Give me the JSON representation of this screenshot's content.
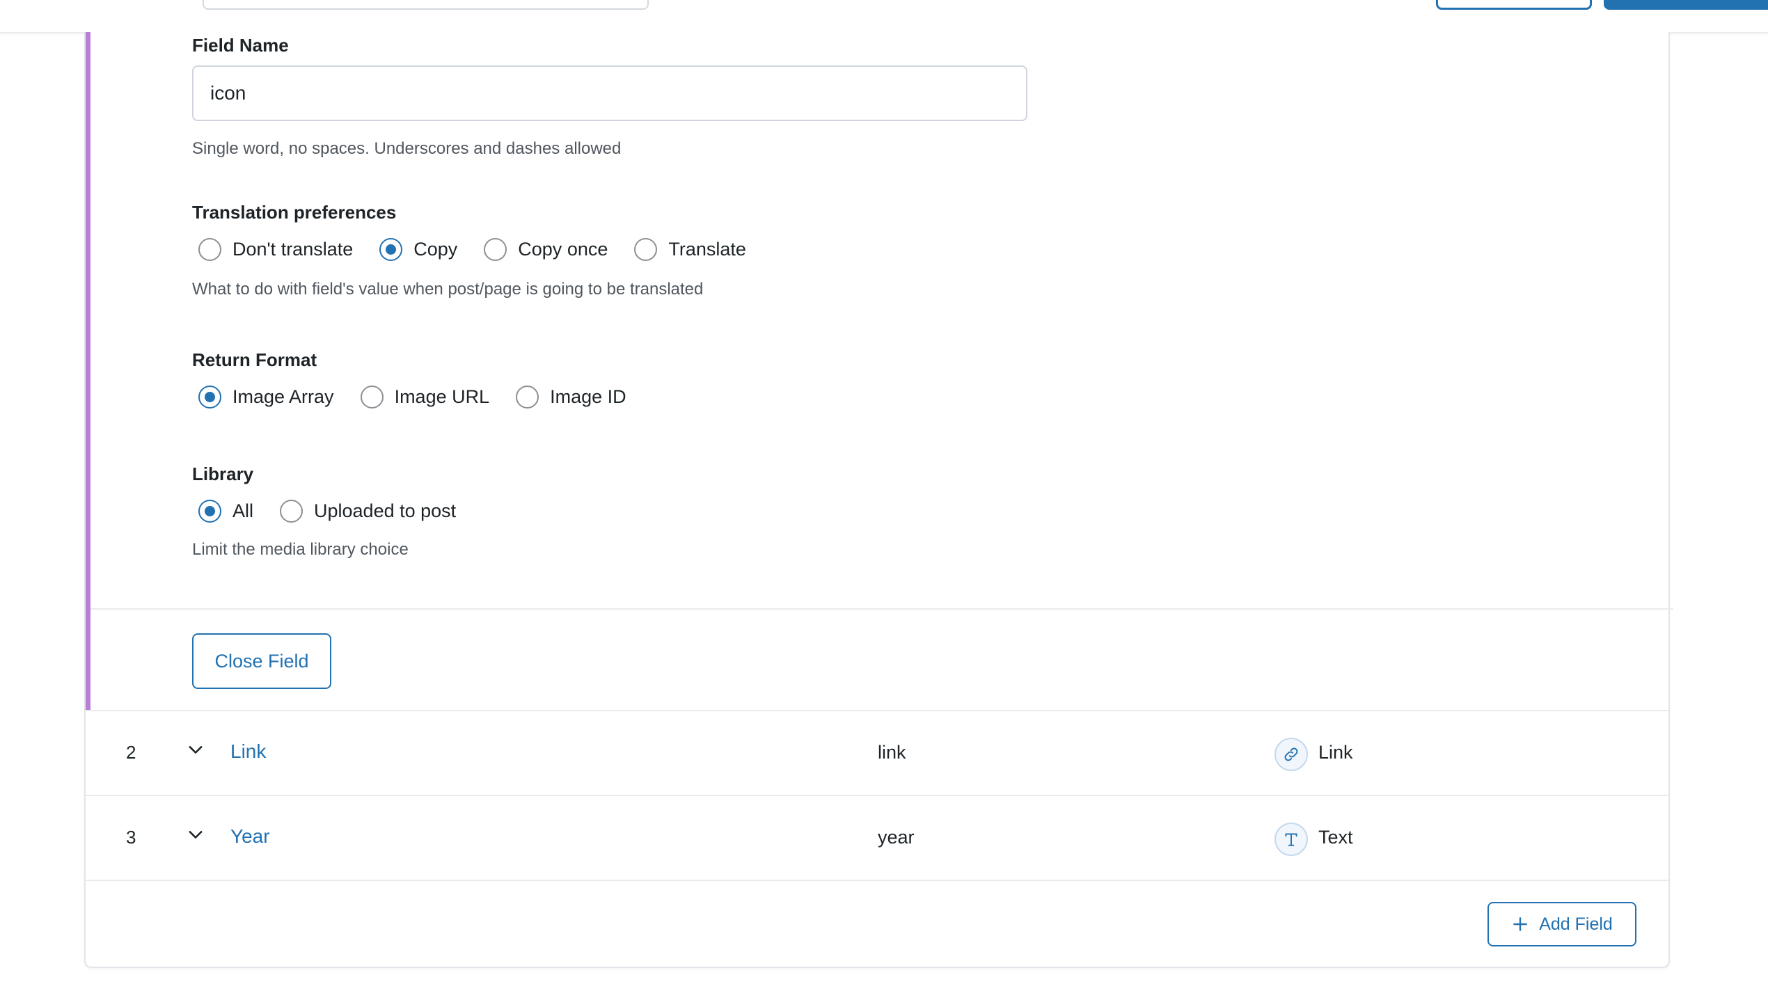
{
  "field_settings": {
    "field_name": {
      "label": "Field Name",
      "value": "icon",
      "help": "Single word, no spaces. Underscores and dashes allowed"
    },
    "translation": {
      "label": "Translation preferences",
      "options": [
        "Don't translate",
        "Copy",
        "Copy once",
        "Translate"
      ],
      "selected": "Copy",
      "help": "What to do with field's value when post/page is going to be translated"
    },
    "return_format": {
      "label": "Return Format",
      "options": [
        "Image Array",
        "Image URL",
        "Image ID"
      ],
      "selected": "Image Array"
    },
    "library": {
      "label": "Library",
      "options": [
        "All",
        "Uploaded to post"
      ],
      "selected": "All",
      "help": "Limit the media library choice"
    },
    "close_label": "Close Field"
  },
  "fields": [
    {
      "order": "2",
      "label": "Link",
      "name": "link",
      "type": "Link",
      "icon": "link-icon"
    },
    {
      "order": "3",
      "label": "Year",
      "name": "year",
      "type": "Text",
      "icon": "text-icon"
    }
  ],
  "footer": {
    "add_label": "Add Field",
    "add_icon": "plus-icon"
  },
  "colors": {
    "accent": "#2271b1",
    "open_field_border": "#b77fd6"
  }
}
